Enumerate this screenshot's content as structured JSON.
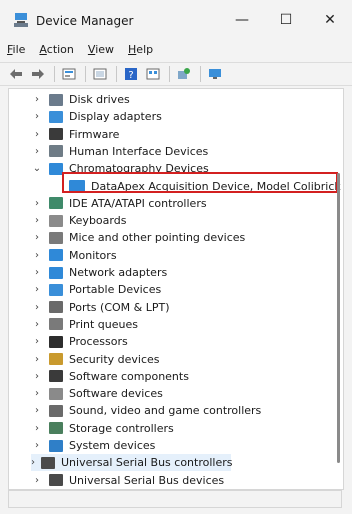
{
  "window": {
    "title": "Device Manager",
    "minimize": "—",
    "maximize": "☐",
    "close": "✕"
  },
  "menu": [
    {
      "prefix": "",
      "accel": "F",
      "rest": "ile"
    },
    {
      "prefix": "",
      "accel": "A",
      "rest": "ction"
    },
    {
      "prefix": "",
      "accel": "V",
      "rest": "iew"
    },
    {
      "prefix": "",
      "accel": "H",
      "rest": "elp"
    }
  ],
  "toolbar": [
    "back-icon",
    "forward-icon",
    "properties-icon",
    "show-hide-icon",
    "help-icon",
    "view-icon",
    "update-driver-icon",
    "scan-hardware-icon"
  ],
  "tree": {
    "items": [
      {
        "label": "Disk drives",
        "icon": "disk-icon",
        "color": "#6b7b8c"
      },
      {
        "label": "Display adapters",
        "icon": "display-adapter-icon",
        "color": "#3a8fd9"
      },
      {
        "label": "Firmware",
        "icon": "firmware-icon",
        "color": "#3a3a3a"
      },
      {
        "label": "Human Interface Devices",
        "icon": "hid-icon",
        "color": "#6f7c86"
      },
      {
        "label": "Chromatography Devices",
        "icon": "monitor-icon",
        "color": "#2f89d8",
        "expanded": true
      },
      {
        "label": "DataApex Acquisition Device, Model Colibrick",
        "icon": "device-icon",
        "color": "#2f89d8",
        "child": true
      },
      {
        "label": "IDE ATA/ATAPI controllers",
        "icon": "ide-icon",
        "color": "#3f8a6a"
      },
      {
        "label": "Keyboards",
        "icon": "keyboard-icon",
        "color": "#8b8b8b"
      },
      {
        "label": "Mice and other pointing devices",
        "icon": "mouse-icon",
        "color": "#7a7a7a"
      },
      {
        "label": "Monitors",
        "icon": "monitor-icon",
        "color": "#2f89d8"
      },
      {
        "label": "Network adapters",
        "icon": "network-icon",
        "color": "#2f89d8"
      },
      {
        "label": "Portable Devices",
        "icon": "portable-icon",
        "color": "#3a8fd9"
      },
      {
        "label": "Ports (COM & LPT)",
        "icon": "port-icon",
        "color": "#6a6a6a"
      },
      {
        "label": "Print queues",
        "icon": "printer-icon",
        "color": "#7a7a7a"
      },
      {
        "label": "Processors",
        "icon": "processor-icon",
        "color": "#2d2d2d"
      },
      {
        "label": "Security devices",
        "icon": "security-icon",
        "color": "#c99a2e"
      },
      {
        "label": "Software components",
        "icon": "software-component-icon",
        "color": "#3a3a3a"
      },
      {
        "label": "Software devices",
        "icon": "software-device-icon",
        "color": "#8a8a8a"
      },
      {
        "label": "Sound, video and game controllers",
        "icon": "sound-icon",
        "color": "#6a6a6a"
      },
      {
        "label": "Storage controllers",
        "icon": "storage-icon",
        "color": "#4a7f5d"
      },
      {
        "label": "System devices",
        "icon": "system-icon",
        "color": "#2f7fc8"
      },
      {
        "label": "Universal Serial Bus controllers",
        "icon": "usb-icon",
        "color": "#4a4a4a",
        "selected": true
      },
      {
        "label": "Universal Serial Bus devices",
        "icon": "usb-icon",
        "color": "#4a4a4a"
      }
    ]
  },
  "colors": {
    "highlight_border": "#d32020",
    "selection": "#e5f0fb"
  }
}
